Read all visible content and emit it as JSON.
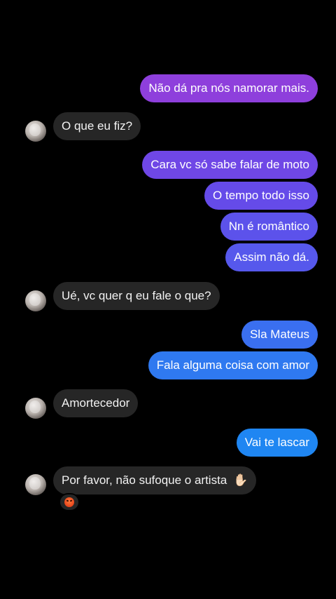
{
  "messages": [
    {
      "from": "me",
      "text": "Não dá pra nós namorar mais.",
      "color": "#8e3fdc"
    },
    {
      "from": "them",
      "text": "O que eu fiz?"
    },
    {
      "from": "me",
      "text": "Cara vc só sabe falar de moto",
      "color": "#6f47e6"
    },
    {
      "from": "me",
      "text": "O tempo todo isso",
      "color": "#654be9"
    },
    {
      "from": "me",
      "text": "Nn é romântico",
      "color": "#5c52eb"
    },
    {
      "from": "me",
      "text": "Assim não dá.",
      "color": "#5658ec"
    },
    {
      "from": "them",
      "text": "Ué, vc quer q eu fale o que?"
    },
    {
      "from": "me",
      "text": "Sla Mateus",
      "color": "#3a6ff0"
    },
    {
      "from": "me",
      "text": "Fala alguma coisa com amor",
      "color": "#2f79f0"
    },
    {
      "from": "them",
      "text": "Amortecedor"
    },
    {
      "from": "me",
      "text": "Vai te lascar",
      "color": "#1f86f2"
    },
    {
      "from": "them",
      "text": "Por favor, não sufoque o artista",
      "emoji": "✋🏻",
      "reaction": "angry-face"
    }
  ]
}
